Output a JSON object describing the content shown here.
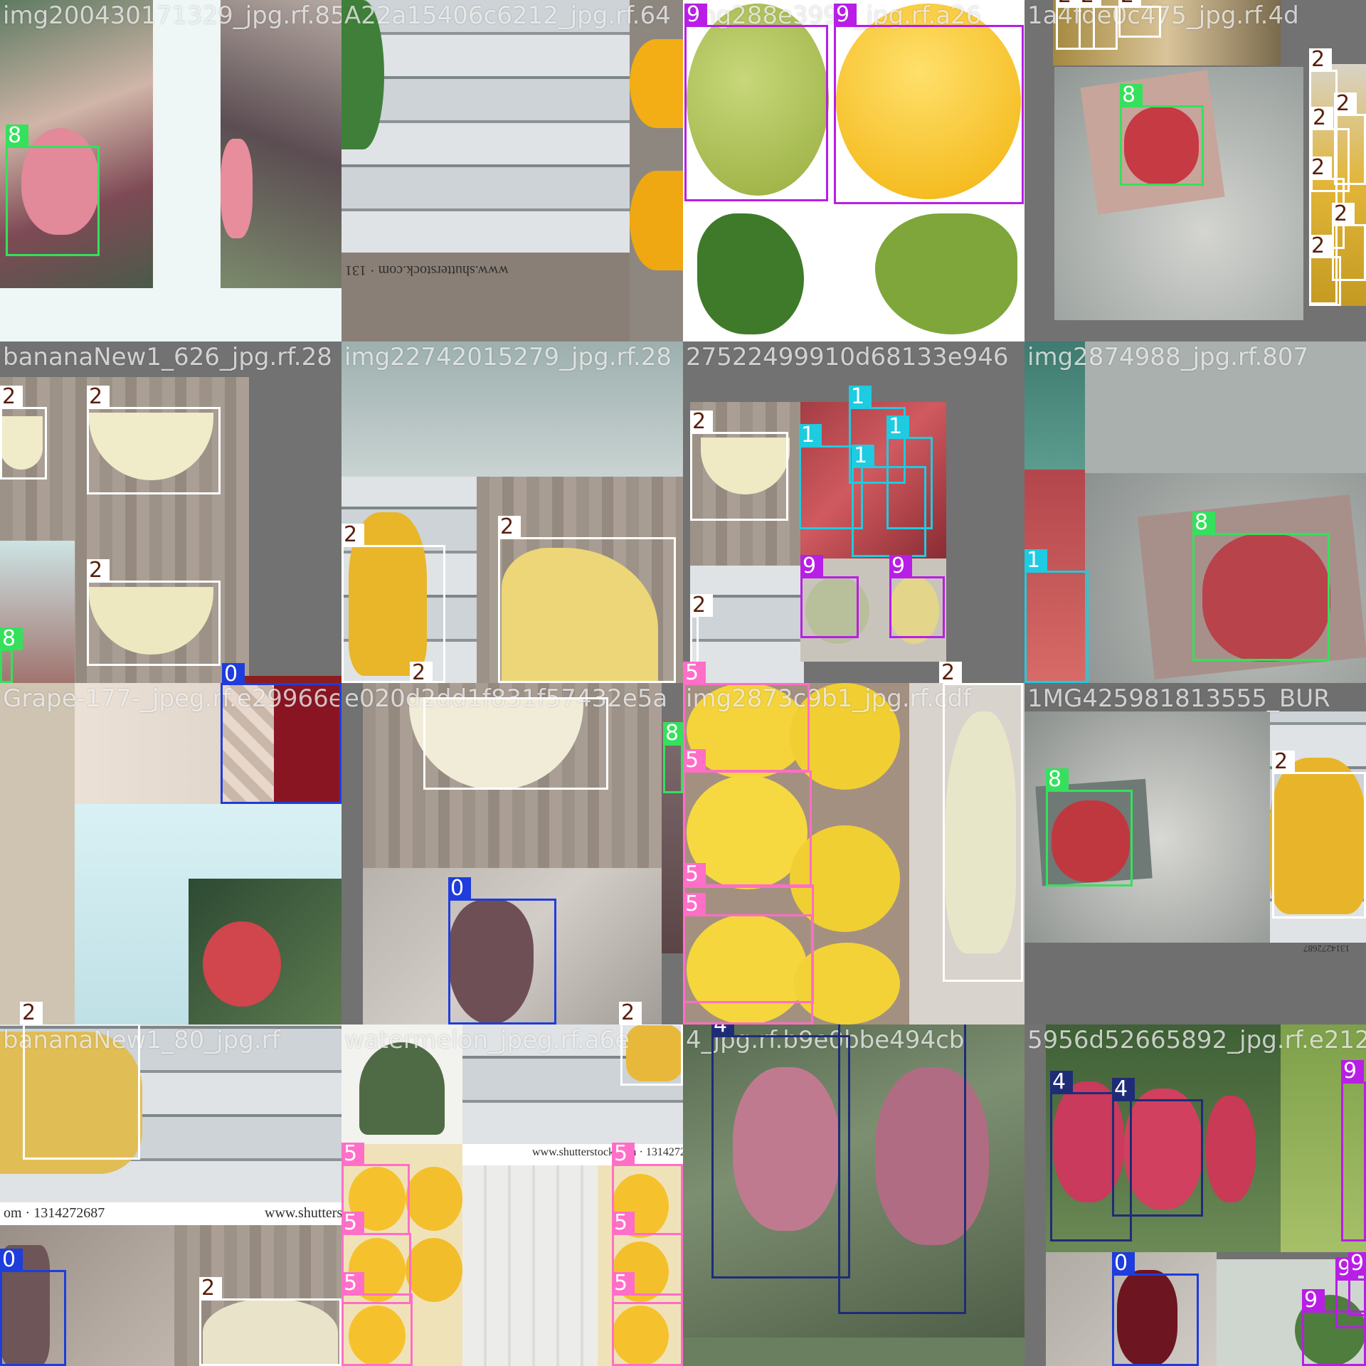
{
  "tiles": [
    {
      "name": "tile-1",
      "title": "img200430171329_jpg.rf.851"
    },
    {
      "name": "tile-2",
      "title": "A22a15406c6212_jpg.rf.64"
    },
    {
      "name": "tile-3",
      "title": "img288e3992_jpg.rf.a26"
    },
    {
      "name": "tile-4",
      "title": "1a4fde0c475_jpg.rf.4d"
    },
    {
      "name": "tile-5",
      "title": "bananaNew1_626_jpg.rf.28"
    },
    {
      "name": "tile-6",
      "title": "img22742015279_jpg.rf.28"
    },
    {
      "name": "tile-7",
      "title": "27522499910d68133e946"
    },
    {
      "name": "tile-8",
      "title": "img2874988_jpg.rf.807"
    },
    {
      "name": "tile-9",
      "title": "Grape-177-_jpeg.rf.e29966e"
    },
    {
      "name": "tile-10",
      "title": "e020d2dd1f831f57432e5a"
    },
    {
      "name": "tile-11",
      "title": "img2873c9b1_jpg.rf.cdf"
    },
    {
      "name": "tile-12",
      "title": "1MG425981813555_BUR"
    },
    {
      "name": "tile-13",
      "title": "bananaNew1_80_jpg.rf"
    },
    {
      "name": "tile-14",
      "title": "watermelon_jpeg.rf.a6e"
    },
    {
      "name": "tile-15",
      "title": "4_jpg.rf.b9e0bbe494cb"
    },
    {
      "name": "tile-16",
      "title": "5956d52665892_jpg.rf.e212c"
    }
  ],
  "watermarks": {
    "shutter_1": "www.shutterstock.com · 131",
    "shutter_2": "www.shutterstock.com · 1314272687",
    "shutter_3": "om · 1314272687",
    "shutter_4": "www.shuttersto",
    "shutter_5": "1314272687"
  },
  "class_colors": {
    "0": "#1f3cdc",
    "1": "#1ecbe1",
    "2": "#ffffff",
    "4": "#1e2c78",
    "5": "#ff6ec7",
    "8": "#35e05c",
    "9": "#b81ee6"
  },
  "annotations": [
    {
      "tile": 1,
      "label": "8"
    },
    {
      "tile": 3,
      "label": "9"
    },
    {
      "tile": 3,
      "label": "9"
    },
    {
      "tile": 4,
      "label": "2"
    },
    {
      "tile": 4,
      "label": "2"
    },
    {
      "tile": 4,
      "label": "2"
    },
    {
      "tile": 4,
      "label": "8"
    },
    {
      "tile": 4,
      "label": "2"
    },
    {
      "tile": 4,
      "label": "2"
    },
    {
      "tile": 4,
      "label": "2"
    },
    {
      "tile": 4,
      "label": "2"
    },
    {
      "tile": 4,
      "label": "2"
    },
    {
      "tile": 4,
      "label": "2"
    },
    {
      "tile": 5,
      "label": "2"
    },
    {
      "tile": 5,
      "label": "2"
    },
    {
      "tile": 5,
      "label": "2"
    },
    {
      "tile": 5,
      "label": "8"
    },
    {
      "tile": 5,
      "label": "0"
    },
    {
      "tile": 6,
      "label": "2"
    },
    {
      "tile": 6,
      "label": "2"
    },
    {
      "tile": 6,
      "label": "2"
    },
    {
      "tile": 7,
      "label": "2"
    },
    {
      "tile": 7,
      "label": "1"
    },
    {
      "tile": 7,
      "label": "1"
    },
    {
      "tile": 7,
      "label": "1"
    },
    {
      "tile": 7,
      "label": "1"
    },
    {
      "tile": 7,
      "label": "9"
    },
    {
      "tile": 7,
      "label": "9"
    },
    {
      "tile": 7,
      "label": "2"
    },
    {
      "tile": 7,
      "label": "5"
    },
    {
      "tile": 7,
      "label": "2"
    },
    {
      "tile": 8,
      "label": "8"
    },
    {
      "tile": 8,
      "label": "1"
    },
    {
      "tile": 9,
      "label": "0"
    },
    {
      "tile": 9,
      "label": "2"
    },
    {
      "tile": 10,
      "label": "8"
    },
    {
      "tile": 10,
      "label": "0"
    },
    {
      "tile": 10,
      "label": "2"
    },
    {
      "tile": 11,
      "label": "5"
    },
    {
      "tile": 11,
      "label": "5"
    },
    {
      "tile": 11,
      "label": "5"
    },
    {
      "tile": 12,
      "label": "8"
    },
    {
      "tile": 12,
      "label": "2"
    },
    {
      "tile": 13,
      "label": "0"
    },
    {
      "tile": 13,
      "label": "2"
    },
    {
      "tile": 14,
      "label": "5"
    },
    {
      "tile": 14,
      "label": "5"
    },
    {
      "tile": 14,
      "label": "5"
    },
    {
      "tile": 14,
      "label": "5"
    },
    {
      "tile": 14,
      "label": "5"
    },
    {
      "tile": 14,
      "label": "5"
    },
    {
      "tile": 15,
      "label": "4"
    },
    {
      "tile": 15,
      "label": "4"
    },
    {
      "tile": 16,
      "label": "4"
    },
    {
      "tile": 16,
      "label": "4"
    },
    {
      "tile": 16,
      "label": "0"
    },
    {
      "tile": 16,
      "label": "9"
    },
    {
      "tile": 16,
      "label": "9"
    },
    {
      "tile": 16,
      "label": "9"
    },
    {
      "tile": 16,
      "label": "9"
    }
  ]
}
